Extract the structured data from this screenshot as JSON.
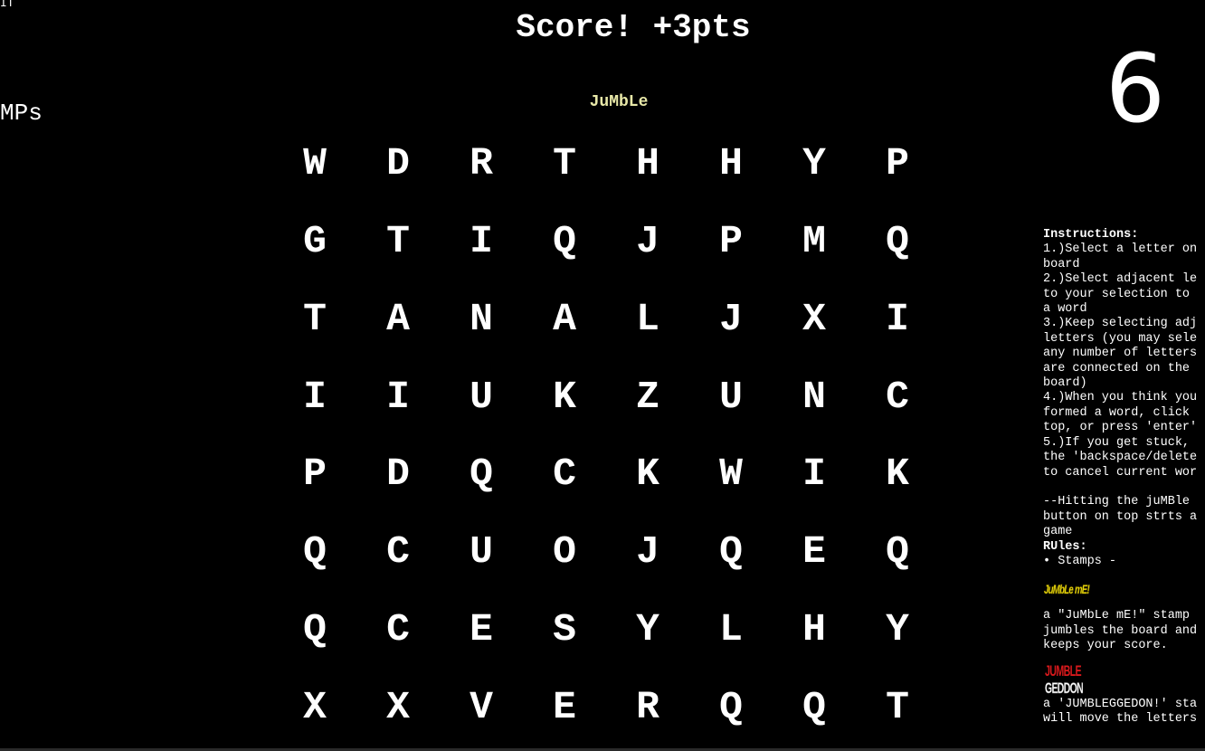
{
  "corner_text": "IT",
  "left_label": "MPs",
  "score_banner": "Score! +3pts",
  "counter": "6",
  "title_button": "JuMbLe",
  "board": [
    [
      "W",
      "D",
      "R",
      "T",
      "H",
      "H",
      "Y",
      "P"
    ],
    [
      "G",
      "T",
      "I",
      "Q",
      "J",
      "P",
      "M",
      "Q"
    ],
    [
      "T",
      "A",
      "N",
      "A",
      "L",
      "J",
      "X",
      "I"
    ],
    [
      "I",
      "I",
      "U",
      "K",
      "Z",
      "U",
      "N",
      "C"
    ],
    [
      "P",
      "D",
      "Q",
      "C",
      "K",
      "W",
      "I",
      "K"
    ],
    [
      "Q",
      "C",
      "U",
      "O",
      "J",
      "Q",
      "E",
      "Q"
    ],
    [
      "Q",
      "C",
      "E",
      "S",
      "Y",
      "L",
      "H",
      "Y"
    ],
    [
      "X",
      "X",
      "V",
      "E",
      "R",
      "Q",
      "Q",
      "T"
    ]
  ],
  "instructions": {
    "heading": "Instructions:",
    "lines_before_rules": [
      "1.)Select a letter on",
      "board",
      "2.)Select adjacent le",
      "to your selection to",
      "a word",
      "3.)Keep selecting adj",
      "letters (you may sele",
      "any number of letters",
      "are connected on the",
      "board)",
      "4.)When you think you",
      "formed a word, click",
      "top, or press 'enter'",
      "5.)If you get stuck,",
      "the 'backspace/delete",
      "to cancel current wor",
      "",
      "--Hitting the juMBle",
      "button on top strts a",
      "game"
    ],
    "rules_heading": "RUles:",
    "stamps_item": "• Stamps -",
    "stamp1_label": "JuMbLe mE!",
    "stamp1_desc": [
      "a \"JuMbLe mE!\" stamp",
      "jumbles the board and",
      "keeps your score."
    ],
    "stamp2_label_top": "JUMBLE",
    "stamp2_label_bottom": "GEDDON",
    "stamp2_desc": [
      "a 'JUMBLEGGEDON!' sta",
      "will move the letters"
    ]
  },
  "colors": {
    "background": "#000000",
    "text": "#ffffff",
    "title_button": "#e8e8a8",
    "stamp_yellow": "#f2e10d",
    "stamp_red": "#d8191c"
  }
}
